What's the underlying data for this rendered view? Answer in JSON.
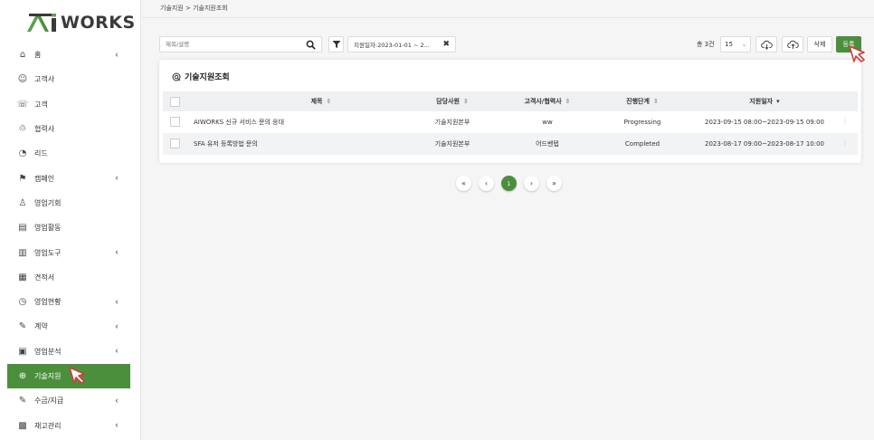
{
  "logo": {
    "text": "WORKS",
    "icon": "ai-logo-icon"
  },
  "breadcrumb": "기술지원 > 기술지원조회",
  "sidebar": {
    "items": [
      {
        "label": "홈",
        "icon": "home-icon",
        "chevron": true
      },
      {
        "label": "고객사",
        "icon": "company-icon",
        "chevron": false
      },
      {
        "label": "고객",
        "icon": "customer-icon",
        "chevron": false
      },
      {
        "label": "협력사",
        "icon": "partner-icon",
        "chevron": false
      },
      {
        "label": "리드",
        "icon": "lead-icon",
        "chevron": false
      },
      {
        "label": "캠페인",
        "icon": "campaign-icon",
        "chevron": true
      },
      {
        "label": "영업기회",
        "icon": "opportunity-icon",
        "chevron": false
      },
      {
        "label": "영업활동",
        "icon": "activity-icon",
        "chevron": false
      },
      {
        "label": "영업도구",
        "icon": "tools-icon",
        "chevron": true
      },
      {
        "label": "견적서",
        "icon": "quote-icon",
        "chevron": false
      },
      {
        "label": "영업현황",
        "icon": "status-icon",
        "chevron": true
      },
      {
        "label": "계약",
        "icon": "contract-icon",
        "chevron": true
      },
      {
        "label": "영업분석",
        "icon": "analysis-icon",
        "chevron": true
      },
      {
        "label": "기술지원",
        "icon": "support-icon",
        "chevron": false,
        "active": true
      },
      {
        "label": "수금/지급",
        "icon": "payment-icon",
        "chevron": true
      },
      {
        "label": "재고관리",
        "icon": "inventory-icon",
        "chevron": true
      }
    ]
  },
  "toolbar": {
    "search_placeholder": "제목/설명",
    "filter_chip": "지원일자:2023-01-01 ~ 2...",
    "total": "총 3건",
    "page_size": "15",
    "delete_label": "삭제",
    "register_label": "등록"
  },
  "card": {
    "title": "기술지원조회"
  },
  "table": {
    "columns": [
      "제목",
      "담당사원",
      "고객사/협력사",
      "진행단계",
      "지원일자"
    ],
    "rows": [
      [
        "AIWORKS 신규 서비스 문의 응대",
        "기술지원본부",
        "ww",
        "Progressing",
        "2023-09-15 08:00~2023-09-15 09:00"
      ],
      [
        "SFA 유저 등록방법 문의",
        "기술지원본부",
        "어드벤텝",
        "Completed",
        "2023-08-17 09:00~2023-08-17 10:00"
      ]
    ]
  },
  "pagination": {
    "first": "«",
    "prev": "‹",
    "current": "1",
    "next": "›",
    "last": "»"
  },
  "colors": {
    "accent": "#4b8f3d"
  }
}
